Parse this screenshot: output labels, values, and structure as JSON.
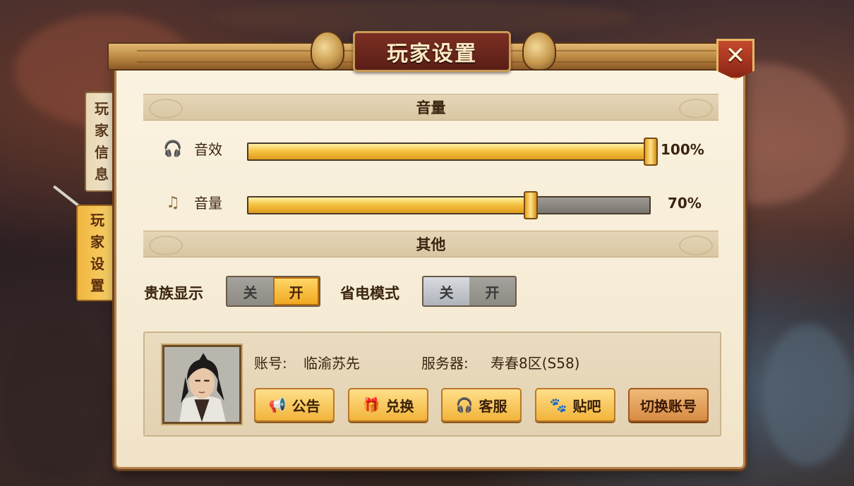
{
  "window": {
    "title": "玩家设置",
    "close_icon": "close-icon"
  },
  "tabs": [
    {
      "label_chars": [
        "玩",
        "家",
        "信",
        "息"
      ],
      "active": false
    },
    {
      "label_chars": [
        "玩",
        "家",
        "设",
        "置"
      ],
      "active": true
    }
  ],
  "volume_section": {
    "header": "音量",
    "sound_effects": {
      "label": "音效",
      "value": 1.0,
      "percent_text": "100%",
      "icon": "headphones-icon"
    },
    "music": {
      "label": "音量",
      "value": 0.7,
      "percent_text": "70%",
      "icon": "music-note-icon"
    }
  },
  "other_section": {
    "header": "其他",
    "noble_display": {
      "label": "贵族显示",
      "off": "关",
      "on": "开",
      "state": "on"
    },
    "power_saving": {
      "label": "省电模式",
      "off": "关",
      "on": "开",
      "state": "off"
    }
  },
  "account": {
    "account_label": "账号:",
    "account_name": "临渝苏先",
    "server_label": "服务器:",
    "server_name": "寿春8区(S58)",
    "buttons": [
      {
        "label": "公告",
        "icon": "megaphone-icon"
      },
      {
        "label": "兑换",
        "icon": "gift-icon"
      },
      {
        "label": "客服",
        "icon": "headset-icon"
      },
      {
        "label": "贴吧",
        "icon": "paw-icon"
      }
    ],
    "switch_label": "切换账号"
  },
  "colors": {
    "accent_gold": "#f2b43a",
    "title_red": "#5a1e17",
    "panel_parchment": "#f6ecd6"
  }
}
